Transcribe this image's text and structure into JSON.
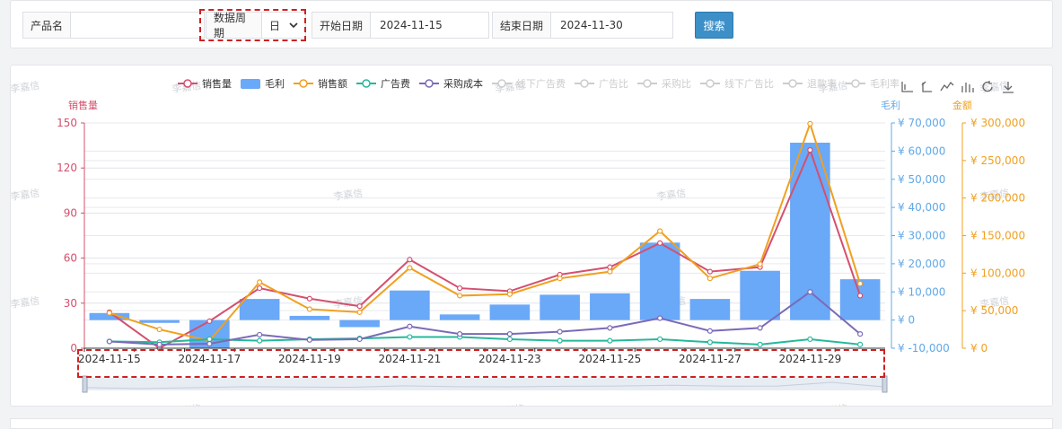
{
  "filters": {
    "product_label": "产品名",
    "product_value": "",
    "period_label": "数据周期",
    "period_value": "日",
    "start_label": "开始日期",
    "start_value": "2024-11-15",
    "end_label": "结束日期",
    "end_value": "2024-11-30",
    "search_label": "搜索"
  },
  "watermark": "李嘉信",
  "colors": {
    "sales_qty": "#d4506e",
    "profit": "#6aa8f8",
    "sales_amount": "#f0a020",
    "ad_fee": "#25b89a",
    "purchase_cost": "#7b6ab8",
    "inactive": "#cccccc",
    "left_axis": "#d4506e",
    "mid_axis": "#60a8e8",
    "right_axis": "#f0a020"
  },
  "toolbar_icons": [
    "zoom-icon",
    "zoom-reset-icon",
    "line-chart-icon",
    "bar-chart-icon",
    "restore-icon",
    "download-icon"
  ],
  "chart_data": {
    "type": "bar",
    "categories": [
      "2024-11-15",
      "2024-11-16",
      "2024-11-17",
      "2024-11-18",
      "2024-11-19",
      "2024-11-20",
      "2024-11-21",
      "2024-11-22",
      "2024-11-23",
      "2024-11-24",
      "2024-11-25",
      "2024-11-26",
      "2024-11-27",
      "2024-11-28",
      "2024-11-29",
      "2024-11-30"
    ],
    "x_tick_labels": [
      "2024-11-15",
      "2024-11-17",
      "2024-11-19",
      "2024-11-21",
      "2024-11-23",
      "2024-11-25",
      "2024-11-27",
      "2024-11-29"
    ],
    "legend": [
      {
        "name": "销售量",
        "key": "sales_qty",
        "type": "line",
        "active": true
      },
      {
        "name": "毛利",
        "key": "profit",
        "type": "bar",
        "active": true
      },
      {
        "name": "销售额",
        "key": "sales_amount",
        "type": "line",
        "active": true
      },
      {
        "name": "广告费",
        "key": "ad_fee",
        "type": "line",
        "active": true
      },
      {
        "name": "采购成本",
        "key": "purchase_cost",
        "type": "line",
        "active": true
      },
      {
        "name": "线下广告费",
        "type": "line",
        "active": false
      },
      {
        "name": "广告比",
        "type": "line",
        "active": false
      },
      {
        "name": "采购比",
        "type": "line",
        "active": false
      },
      {
        "name": "线下广告比",
        "type": "line",
        "active": false
      },
      {
        "name": "退款率",
        "type": "line",
        "active": false
      },
      {
        "name": "毛利率",
        "type": "line",
        "active": false
      }
    ],
    "axes": {
      "left": {
        "name": "销售量",
        "min": 0,
        "max": 150,
        "ticks": [
          "0",
          "30",
          "60",
          "90",
          "120",
          "150"
        ]
      },
      "mid": {
        "name": "毛利",
        "min": -10000,
        "max": 70000,
        "ticks": [
          "¥ -10,000",
          "¥ 0",
          "¥ 10,000",
          "¥ 20,000",
          "¥ 30,000",
          "¥ 40,000",
          "¥ 50,000",
          "¥ 60,000",
          "¥ 70,000"
        ]
      },
      "right": {
        "name": "金额",
        "min": 0,
        "max": 300000,
        "ticks": [
          "¥ 0",
          "¥ 50,000",
          "¥ 100,000",
          "¥ 150,000",
          "¥ 200,000",
          "¥ 250,000",
          "¥ 300,000"
        ]
      }
    },
    "series": [
      {
        "name": "毛利",
        "axis": "mid",
        "values": [
          2500,
          -1000,
          -10000,
          7500,
          1500,
          -2500,
          10500,
          2000,
          5500,
          9000,
          9500,
          27500,
          7500,
          17500,
          63000,
          14500
        ]
      },
      {
        "name": "销售量",
        "axis": "left",
        "values": [
          24,
          0,
          18,
          40,
          33,
          28,
          59,
          40,
          38,
          49,
          54,
          70,
          51,
          54,
          132,
          35
        ]
      },
      {
        "name": "销售额",
        "axis": "right",
        "values": [
          47000,
          25000,
          10000,
          88000,
          52000,
          48000,
          107000,
          70000,
          72000,
          93000,
          102000,
          156000,
          93000,
          112000,
          299000,
          86000
        ]
      },
      {
        "name": "广告费",
        "axis": "right",
        "values": [
          9000,
          8000,
          12000,
          10000,
          12000,
          13000,
          15000,
          15000,
          12000,
          10000,
          10000,
          12000,
          8000,
          5000,
          12000,
          5000
        ]
      },
      {
        "name": "采购成本",
        "axis": "right",
        "values": [
          9000,
          5000,
          6000,
          18000,
          11000,
          12000,
          29000,
          19000,
          19000,
          22000,
          27000,
          40000,
          23000,
          27000,
          75000,
          19000
        ]
      }
    ]
  }
}
